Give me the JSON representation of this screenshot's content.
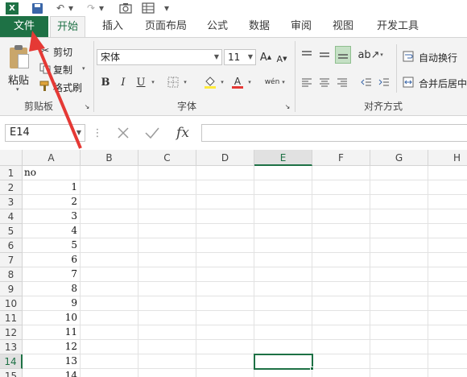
{
  "app": {
    "logo_text": "X"
  },
  "quick_access": {
    "undo": "↶",
    "redo": "↷"
  },
  "tabs": [
    {
      "label": "文件"
    },
    {
      "label": "开始"
    },
    {
      "label": "插入"
    },
    {
      "label": "页面布局"
    },
    {
      "label": "公式"
    },
    {
      "label": "数据"
    },
    {
      "label": "审阅"
    },
    {
      "label": "视图"
    },
    {
      "label": "开发工具"
    }
  ],
  "ribbon": {
    "clipboard": {
      "paste": "粘贴",
      "cut": "剪切",
      "copy": "复制",
      "format_painter": "格式刷",
      "group_label": "剪贴板"
    },
    "font": {
      "font_name": "宋体",
      "font_size": "11",
      "bold": "B",
      "italic": "I",
      "underline": "U",
      "phonetic": "wén",
      "group_label": "字体"
    },
    "alignment": {
      "wrap_text": "自动换行",
      "merge_center": "合并后居中",
      "group_label": "对齐方式"
    }
  },
  "formula_bar": {
    "name_box": "E14",
    "fx_label": "fx",
    "value": ""
  },
  "sheet": {
    "columns": [
      "A",
      "B",
      "C",
      "D",
      "E",
      "F",
      "G",
      "H"
    ],
    "rows": [
      "1",
      "2",
      "3",
      "4",
      "5",
      "6",
      "7",
      "8",
      "9",
      "10",
      "11",
      "12",
      "13",
      "14",
      "15"
    ],
    "col_a_values": [
      "no",
      "1",
      "2",
      "3",
      "4",
      "5",
      "6",
      "7",
      "8",
      "9",
      "10",
      "11",
      "12",
      "13",
      "14"
    ],
    "selected_column": "E",
    "selected_row": "14"
  },
  "annotation": {
    "arrow_color": "#e53935"
  },
  "colors": {
    "accent": "#1e7145",
    "ribbon_bg": "#f3f3f3"
  }
}
